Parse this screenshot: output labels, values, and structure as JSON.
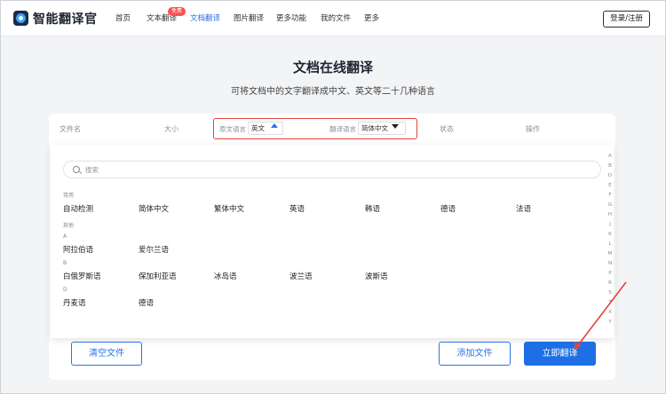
{
  "header": {
    "brand": "智能翻译官",
    "nav": [
      {
        "label": "首页",
        "active": false
      },
      {
        "label": "文本翻译",
        "active": false
      },
      {
        "label": "文档翻译",
        "active": true
      },
      {
        "label": "图片翻译",
        "active": false
      },
      {
        "label": "更多功能",
        "active": false
      },
      {
        "label": "我的文件",
        "active": false
      },
      {
        "label": "更多",
        "active": false
      }
    ],
    "badge": "免费",
    "login": "登录/注册"
  },
  "hero": {
    "title": "文档在线翻译",
    "subtitle": "可将文档中的文字翻译成中文、英文等二十几种语言"
  },
  "table_header": {
    "filename": "文件名",
    "size": "大小",
    "source_label": "原文语言",
    "source_value": "英文",
    "target_label": "翻译语言",
    "target_value": "简体中文",
    "status": "状态",
    "action": "操作"
  },
  "dropdown": {
    "search_placeholder": "搜索",
    "groups": {
      "common": {
        "label": "常用",
        "items": [
          "自动检测",
          "简体中文",
          "繁体中文",
          "英语",
          "韩语",
          "德语",
          "法语"
        ]
      },
      "other": {
        "label": "其他"
      },
      "A": {
        "label": "A",
        "items": [
          "阿拉伯语",
          "爱尔兰语"
        ]
      },
      "B": {
        "label": "B",
        "items": [
          "白俄罗斯语",
          "保加利亚语",
          "冰岛语",
          "波兰语",
          "波斯语"
        ]
      },
      "D": {
        "label": "D",
        "items": [
          "丹麦语",
          "德语"
        ]
      }
    },
    "alphabet": [
      "A",
      "B",
      "D",
      "E",
      "F",
      "G",
      "H",
      "J",
      "K",
      "L",
      "M",
      "N",
      "P",
      "R",
      "S",
      "T",
      "X",
      "Y"
    ]
  },
  "buttons": {
    "clear": "清空文件",
    "add": "添加文件",
    "translate": "立即翻译"
  },
  "colors": {
    "accent": "#2b73e8",
    "primary_button": "#1e6fe5",
    "highlight_border": "#e4433a",
    "badge": "#ff4d4f"
  }
}
